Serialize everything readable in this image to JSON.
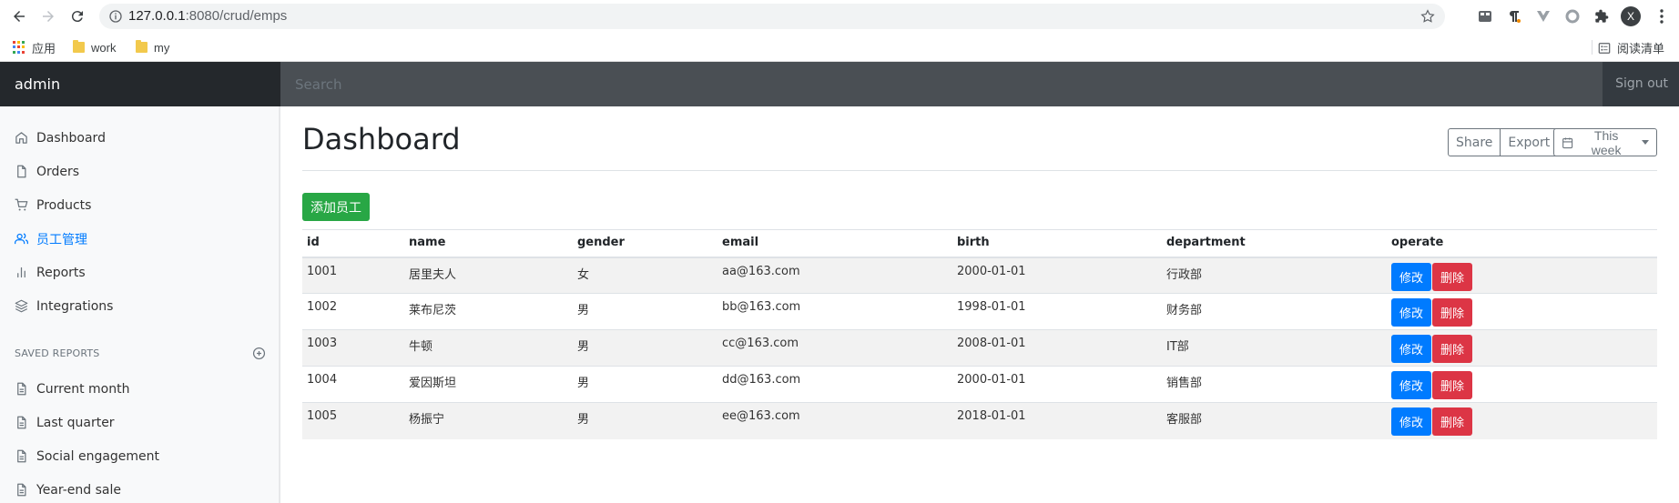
{
  "browser": {
    "url_host": "127.0.0.1",
    "url_rest": ":8080/crud/emps",
    "profile_initial": "X",
    "bookmarks": [
      {
        "label": "应用",
        "kind": "apps"
      },
      {
        "label": "work",
        "kind": "folder"
      },
      {
        "label": "my",
        "kind": "folder"
      }
    ],
    "reading_list": "阅读清单"
  },
  "navbar": {
    "brand": "admin",
    "search_placeholder": "Search",
    "signout": "Sign out"
  },
  "sidebar": {
    "items": [
      {
        "label": "Dashboard",
        "icon": "home-icon",
        "active": false
      },
      {
        "label": "Orders",
        "icon": "file-icon",
        "active": false
      },
      {
        "label": "Products",
        "icon": "cart-icon",
        "active": false
      },
      {
        "label": "员工管理",
        "icon": "users-icon",
        "active": true
      },
      {
        "label": "Reports",
        "icon": "bar-chart-icon",
        "active": false
      },
      {
        "label": "Integrations",
        "icon": "layers-icon",
        "active": false
      }
    ],
    "saved_reports_heading": "SAVED REPORTS",
    "saved_reports": [
      {
        "label": "Current month",
        "icon": "file-text-icon"
      },
      {
        "label": "Last quarter",
        "icon": "file-text-icon"
      },
      {
        "label": "Social engagement",
        "icon": "file-text-icon"
      },
      {
        "label": "Year-end sale",
        "icon": "file-text-icon"
      }
    ]
  },
  "main": {
    "title": "Dashboard",
    "share": "Share",
    "export": "Export",
    "week": "This week",
    "add_button": "添加员工",
    "table": {
      "headers": [
        "id",
        "name",
        "gender",
        "email",
        "birth",
        "department",
        "operate"
      ],
      "rows": [
        [
          "1001",
          "居里夫人",
          "女",
          "aa@163.com",
          "2000-01-01",
          "行政部"
        ],
        [
          "1002",
          "莱布尼茨",
          "男",
          "bb@163.com",
          "1998-01-01",
          "财务部"
        ],
        [
          "1003",
          "牛顿",
          "男",
          "cc@163.com",
          "2008-01-01",
          "IT部"
        ],
        [
          "1004",
          "爱因斯坦",
          "男",
          "dd@163.com",
          "2000-01-01",
          "销售部"
        ],
        [
          "1005",
          "杨振宁",
          "男",
          "ee@163.com",
          "2018-01-01",
          "客服部"
        ]
      ],
      "edit_label": "修改",
      "delete_label": "删除"
    }
  },
  "colors": {
    "primary": "#007bff",
    "success": "#28a745",
    "danger": "#dc3545",
    "navbar": "#343a40"
  }
}
